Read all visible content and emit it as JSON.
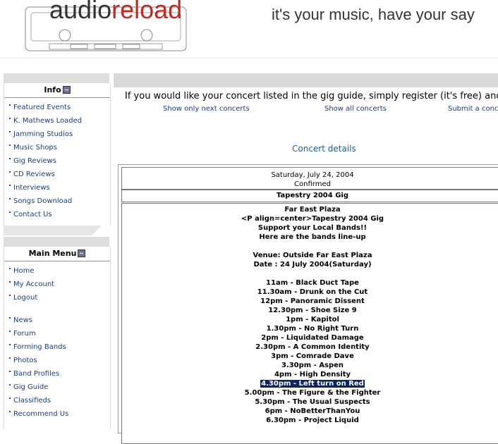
{
  "header": {
    "logo_part1": "audio",
    "logo_part2": "reload",
    "slogan": "it's your music, have your say"
  },
  "info": {
    "title": "Info",
    "items": [
      "Featured Events",
      "K. Mathews Loaded",
      "Jamming Studios",
      "Music Shops",
      "Gig Reviews",
      "CD Reviews",
      "Interviews",
      "Songs Download",
      "Contact Us"
    ]
  },
  "main_menu": {
    "title": "Main Menu",
    "items_a": [
      "Home",
      "My Account",
      "Logout"
    ],
    "items_b": [
      "News",
      "Forum",
      "Forming Bands",
      "Photos",
      "Band Profiles",
      "Gig Guide",
      "Classifieds",
      "Recommend Us"
    ]
  },
  "main": {
    "intro": "If you would like your concert listed in the gig guide, simply register (it's free) and",
    "link_next": "Show only next concerts",
    "link_all": "Show all concerts",
    "link_submit": "Submit a conce",
    "section_title": "Concert details",
    "date": "Saturday, July 24, 2004",
    "status": "Confirmed",
    "event_name": "Tapestry 2004 Gig",
    "desc": [
      "Far East Plaza",
      "<P align=center>Tapestry 2004 Gig",
      "Support your Local Bands!!",
      "Here are the bands line-up",
      "",
      "Venue: Outside Far East Plaza",
      "Date : 24 July 2004(Saturday)",
      "",
      "11am - Black Duct Tape",
      "11.30am - Drunk on the Cut",
      "12pm - Panoramic Dissent",
      "12.30pm - Shoe Size 9",
      "1pm - Kapitol",
      "1.30pm - No Right Turn",
      "2pm - Liquidated Damage",
      "2.30pm - A Common Identity",
      "3pm - Comrade Dave",
      "3.30pm - Aspen",
      "4pm - High Density",
      "4.30pm - Left turn on Red",
      "5.00pm - The Figure & the Fighter",
      "5.30pm - The Usual Suspects",
      "6pm - NoBetterThanYou",
      "6.30pm - Project Liquid"
    ],
    "highlighted_line": "4.30pm - Left turn on Red"
  }
}
